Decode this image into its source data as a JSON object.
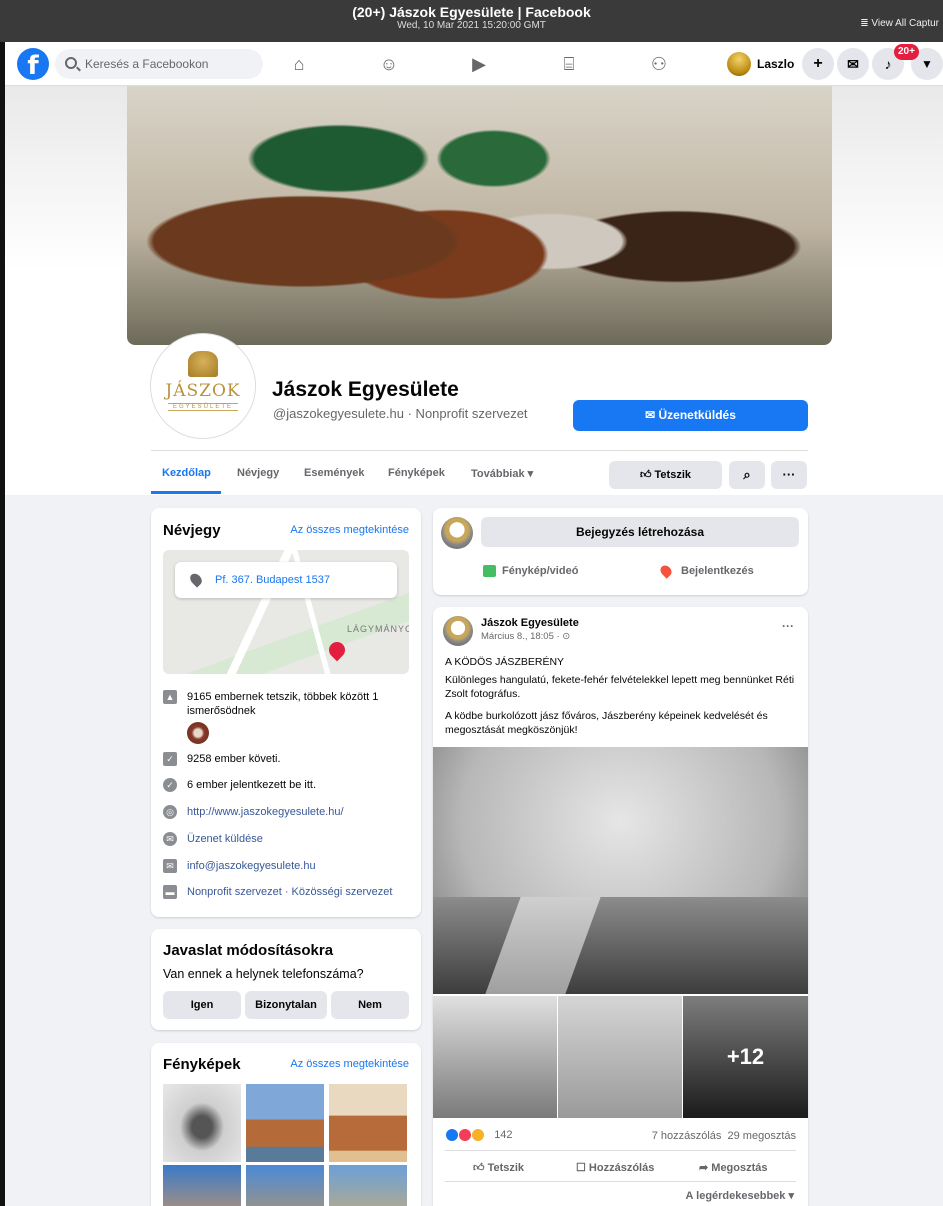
{
  "capture": {
    "title": "(20+) Jászok Egyesülete | Facebook",
    "datetime": "Wed, 10 Mar 2021 15:20:00 GMT",
    "view_all": "View All Captur"
  },
  "header": {
    "search_placeholder": "Keresés a Facebookon",
    "user_name": "Laszlo",
    "notifications_badge": "20+",
    "logo_letter": "f"
  },
  "page": {
    "name": "Jászok Egyesülete",
    "handle": "@jaszokegyesulete.hu · Nonprofit szervezet",
    "message_button": "Üzenetküldés",
    "logo_text": "JÁSZOK",
    "logo_sub": "EGYESÜLETE",
    "tabs": [
      "Kezdőlap",
      "Névjegy",
      "Események",
      "Fényképek",
      "Továbbiak ▾"
    ],
    "like_button": "Tetszik",
    "more_button": "···"
  },
  "about": {
    "title": "Névjegy",
    "see_all": "Az összes megtekintése",
    "address": "Pf. 367. Budapest 1537",
    "map_label": "LÁGYMÁNYO",
    "likes": "9165 embernek tetszik, többek között 1 ismerősödnek",
    "followers": "9258 ember követi.",
    "checkins": "6 ember jelentkezett be itt.",
    "website": "http://www.jaszokegyesulete.hu/",
    "send_message": "Üzenet küldése",
    "email": "info@jaszokegyesulete.hu",
    "category": "Nonprofit szervezet · Közösségi szervezet"
  },
  "suggest": {
    "title": "Javaslat módosításokra",
    "question": "Van ennek a helynek telefonszáma?",
    "yes": "Igen",
    "unsure": "Bizonytalan",
    "no": "Nem"
  },
  "photos": {
    "title": "Fényképek",
    "see_all": "Az összes megtekintése"
  },
  "composer": {
    "create_post": "Bejegyzés létrehozása",
    "photo_video": "Fénykép/videó",
    "checkin": "Bejelentkezés"
  },
  "post": {
    "author": "Jászok Egyesülete",
    "time": "Március 8., 18:05 · ⊙",
    "headline": "A KÖDÖS JÁSZBERÉNY",
    "para1": "Különleges hangulatú, fekete-fehér felvételekkel lepett meg bennünket Réti Zsolt fotográfus.",
    "para2": "A ködbe burkolózott jász főváros, Jászberény képeinek kedvelését és megosztását megköszönjük!",
    "more_photos": "+12",
    "reactions_count": "142",
    "comments_shares": "7 hozzászólás  29 megosztás",
    "like": "Tetszik",
    "comment": "Hozzászólás",
    "share": "Megosztás",
    "sort": "A legérdekesebbek ▾",
    "menu": "···"
  },
  "colors": {
    "brand": "#1877f2",
    "badge": "#e41e3f",
    "background": "#f0f2f5"
  }
}
